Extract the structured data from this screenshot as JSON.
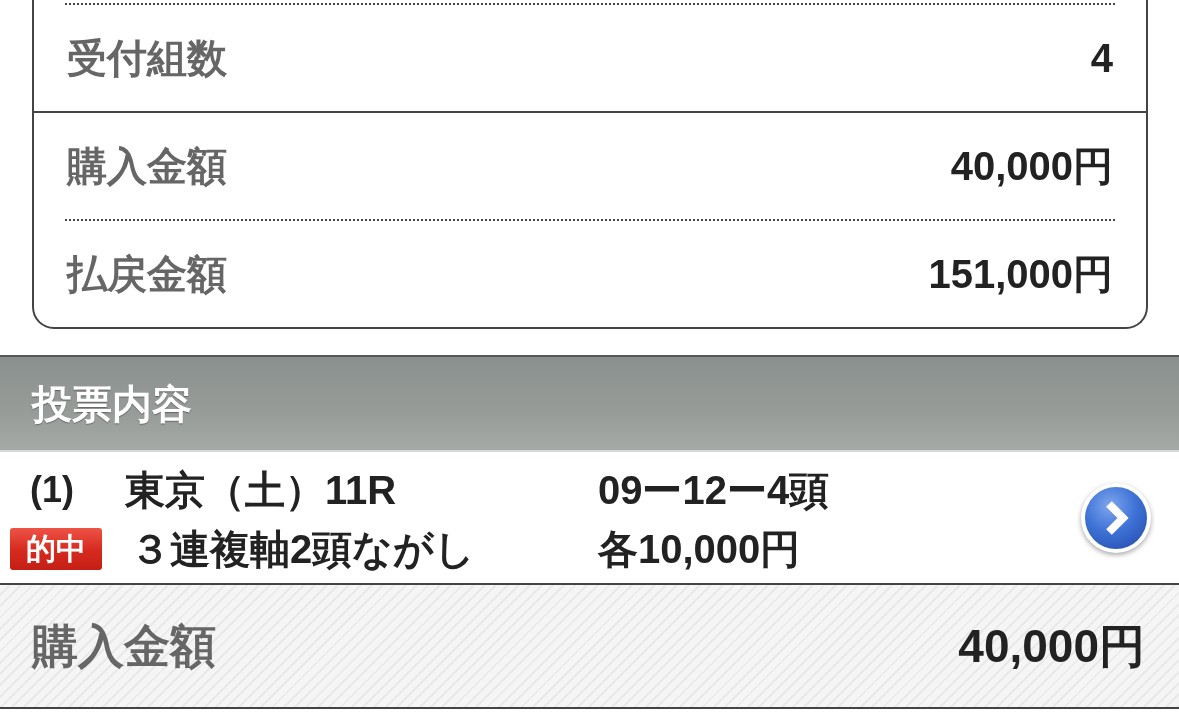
{
  "summary": {
    "rows": [
      {
        "label": "受付組数",
        "value": "4",
        "kind": "dotted"
      },
      {
        "label": "購入金額",
        "value": "40,000円",
        "kind": "solid"
      },
      {
        "label": "払戻金額",
        "value": "151,000円",
        "kind": "dotted"
      }
    ]
  },
  "bet_section": {
    "title": "投票内容",
    "bets": [
      {
        "number": "(1)",
        "race": "東京（土）11R",
        "combination": "09ー12ー4頭",
        "badge": {
          "label": "的中",
          "kind": "hit"
        },
        "bet_type": "３連複軸2頭ながし",
        "amount": "各10,000円"
      }
    ]
  },
  "footer": {
    "label": "購入金額",
    "value": "40,000円"
  }
}
